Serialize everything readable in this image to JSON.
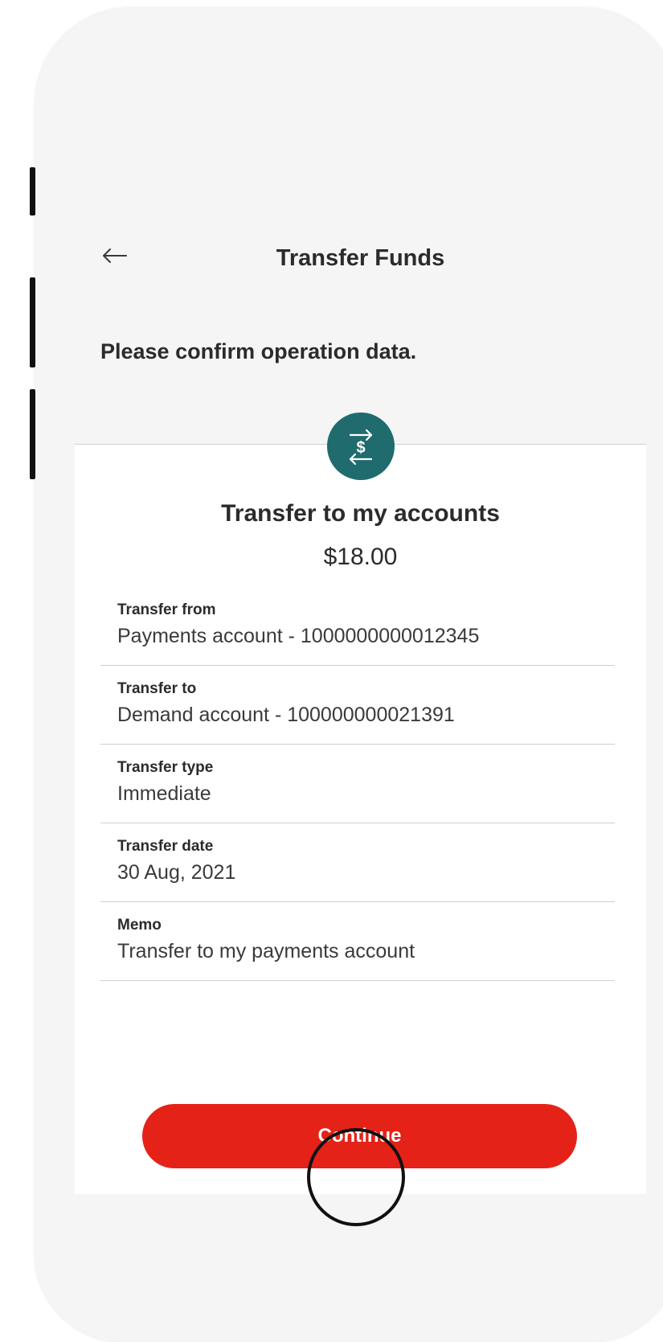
{
  "colors": {
    "accent": "#e52218",
    "icon_background": "#1f6b6e",
    "header_background": "#f5f5f5"
  },
  "icons": {
    "back": "arrow-left-icon",
    "operation": "transfer-funds-icon"
  },
  "header": {
    "title": "Transfer Funds",
    "confirm_text": "Please confirm operation data."
  },
  "operation": {
    "title": "Transfer to my accounts",
    "amount": "$18.00"
  },
  "details": [
    {
      "label": "Transfer from",
      "value": "Payments account - 1000000000012345"
    },
    {
      "label": "Transfer to",
      "value": "Demand account - 100000000021391"
    },
    {
      "label": "Transfer type",
      "value": "Immediate"
    },
    {
      "label": "Transfer date",
      "value": "30 Aug, 2021"
    },
    {
      "label": "Memo",
      "value": "Transfer to my payments account"
    }
  ],
  "actions": {
    "continue_label": "Continue"
  }
}
